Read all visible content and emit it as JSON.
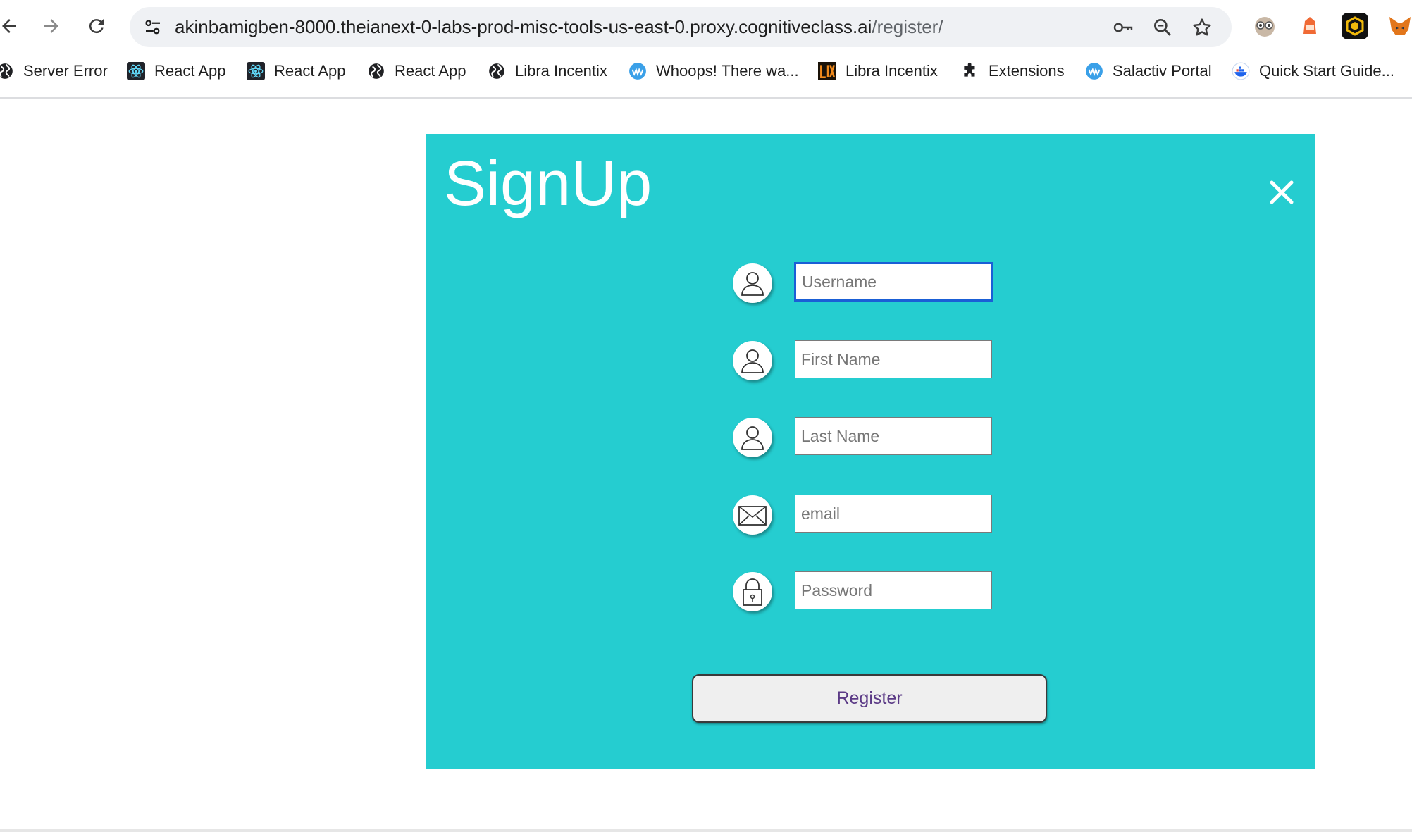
{
  "browser": {
    "url_host": "akinbamigben-8000.theianext-0-labs-prod-misc-tools-us-east-0.proxy.cognitiveclass.ai",
    "url_path": "/register/",
    "bookmarks": [
      {
        "label": "Server Error",
        "icon": "globe-icon"
      },
      {
        "label": "React App",
        "icon": "react-icon"
      },
      {
        "label": "React App",
        "icon": "react-icon"
      },
      {
        "label": "React App",
        "icon": "globe-icon"
      },
      {
        "label": "Libra Incentix",
        "icon": "globe-icon"
      },
      {
        "label": "Whoops! There wa...",
        "icon": "wave-icon"
      },
      {
        "label": "Libra Incentix",
        "icon": "lix-icon"
      },
      {
        "label": "Extensions",
        "icon": "puzzle-icon"
      },
      {
        "label": "Salactiv Portal",
        "icon": "wave-icon"
      },
      {
        "label": "Quick Start Guide...",
        "icon": "docker-icon"
      }
    ]
  },
  "signup": {
    "title": "SignUp",
    "fields": [
      {
        "placeholder": "Username",
        "value": "",
        "icon": "user-icon"
      },
      {
        "placeholder": "First Name",
        "value": "",
        "icon": "user-icon"
      },
      {
        "placeholder": "Last Name",
        "value": "",
        "icon": "user-icon"
      },
      {
        "placeholder": "email",
        "value": "",
        "icon": "envelope-icon"
      },
      {
        "placeholder": "Password",
        "value": "",
        "icon": "lock-icon"
      }
    ],
    "register_label": "Register"
  },
  "colors": {
    "card_background": "#25cdd0",
    "title_text": "#ffffff",
    "register_text": "#5b3a86",
    "focus_ring": "#1a5fd6"
  }
}
